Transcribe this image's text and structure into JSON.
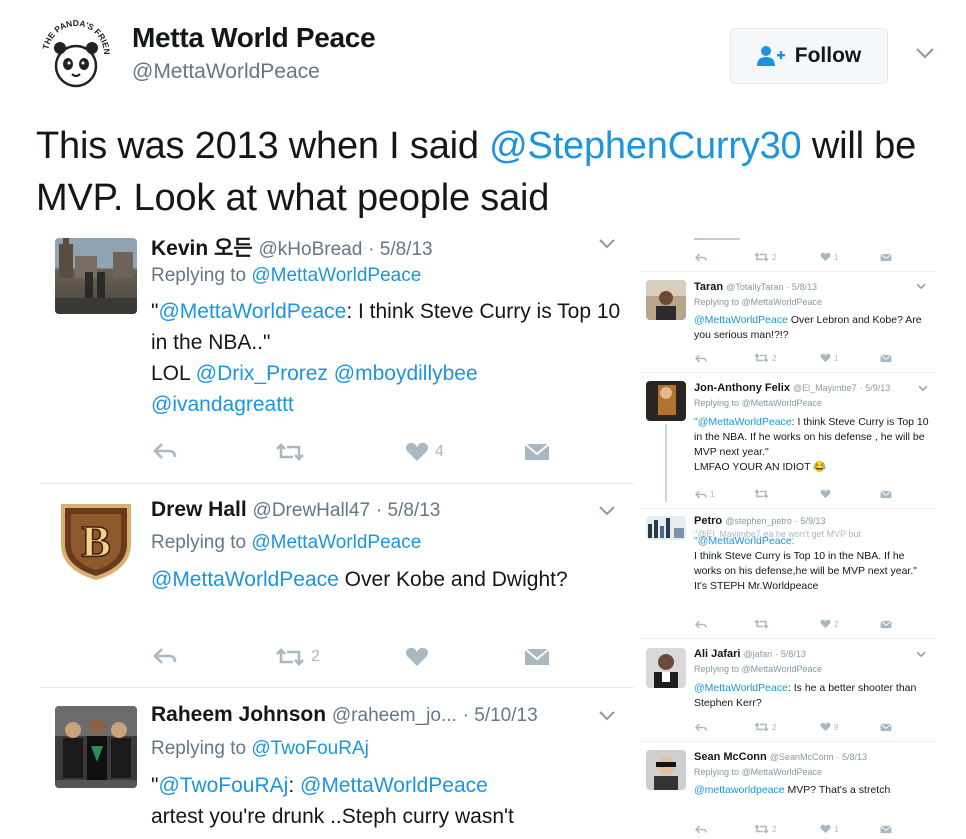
{
  "tweet": {
    "author_name": "Metta World Peace",
    "author_handle": "@MettaWorldPeace",
    "follow_label": "Follow",
    "text_part1": "This was 2013 when I said ",
    "mention": "@StephenCurry30",
    "text_part2": " will be MVP. Look at what people said",
    "avatar_text": "THE PANDA'S FRIEND"
  },
  "replies": [
    {
      "name": "Kevin 오든",
      "handle": "@kHoBread",
      "date": "· 5/8/13",
      "replying_label": "Replying to",
      "replying_to": "@MettaWorldPeace",
      "text_q": "\"",
      "text_mention": "@MettaWorldPeace",
      "text_rest": ": I think Steve Curry is Top 10 in the NBA..\"",
      "text_line2_prefix": "LOL ",
      "mention2": "@Drix_Prorez",
      "mention3": "@mboydillybee",
      "mention4": "@ivandagreattt",
      "retweets": "",
      "likes": "4"
    },
    {
      "name": "Drew Hall",
      "handle": "@DrewHall47",
      "date": "· 5/8/13",
      "replying_label": "Replying to",
      "replying_to": "@MettaWorldPeace",
      "text_mention": "@MettaWorldPeace",
      "text_rest": " Over Kobe and Dwight?",
      "retweets": "2",
      "likes": ""
    },
    {
      "name": "Raheem Johnson",
      "handle": "@raheem_jo...",
      "date": "· 5/10/13",
      "replying_label": "Replying to",
      "replying_to": "@TwoFouRAj",
      "text_q": "\"",
      "text_mention": "@TwoFouRAj",
      "text_sep": ": ",
      "text_mention2": "@MettaWorldPeace",
      "text_rest": "artest you're drunk ..Steph curry wasn't"
    }
  ],
  "side": {
    "top_counts": {
      "retweets": "2",
      "likes": "1"
    },
    "items": [
      {
        "name": "Taran",
        "handle": "@TotallyTaran",
        "date": "· 5/8/13",
        "replying": "Replying to @MettaWorldPeace",
        "mention": "@MettaWorldPeace",
        "text": " Over Lebron and Kobe? Are you serious man!?!?",
        "retweets": "2",
        "likes": "1"
      },
      {
        "name": "Jon-Anthony Felix",
        "handle": "@El_Mayimbe7",
        "date": "· 5/9/13",
        "replying": "Replying to @MettaWorldPeace",
        "quote_mention": "\"@MettaWorldPeace",
        "text": ": I think Steve Curry is Top 10 in the NBA. If he works on his defense , he will be MVP next year.\"",
        "text2": "LMFAO YOUR AN IDIOT 😂",
        "retweets": "",
        "likes": "",
        "replies": "1"
      },
      {
        "name": "Petro",
        "handle": "@stephen_petro",
        "date": "· 5/9/13",
        "replying": "\"@El_Mayimbe7 ea he won't get MVP but",
        "quote_mention": "\"@MettaWorldPeace:",
        "text": "I think Steve Curry is Top 10 in the NBA. If he works on his defense,he will be MVP next year.\" It's STEPH Mr.Worldpeace",
        "likes": "2"
      },
      {
        "name": "Ali Jafari",
        "handle": "@jafari",
        "date": "· 5/8/13",
        "replying": "Replying to @MettaWorldPeace",
        "mention": "@MettaWorldPeace",
        "text": ": Is he a better shooter than Stephen Kerr?",
        "retweets": "2",
        "likes": "9"
      },
      {
        "name": "Sean McConn",
        "handle": "@SeanMcConn",
        "date": "· 5/8/13",
        "replying": "Replying to @MettaWorldPeace",
        "mention": "@mettaworldpeace",
        "text": " MVP? That's a stretch",
        "retweets": "2",
        "likes": "1"
      }
    ]
  },
  "colors": {
    "link": "#1b95e0",
    "muted": "#657786",
    "icon": "#aab8c2"
  }
}
